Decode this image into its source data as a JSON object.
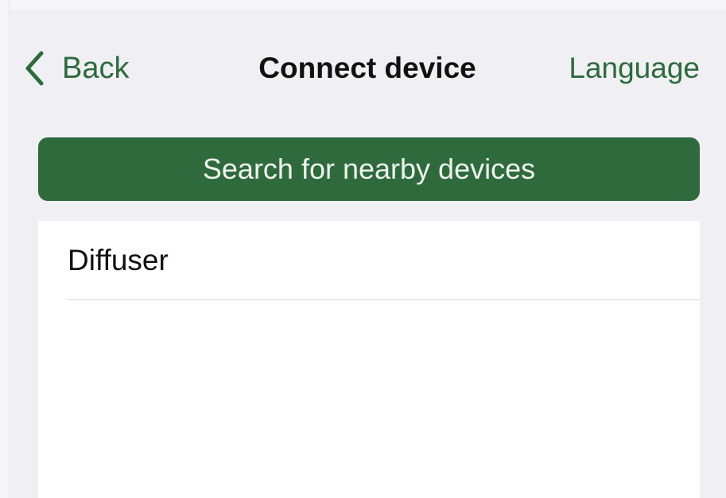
{
  "nav": {
    "back_label": "Back",
    "title": "Connect device",
    "language_label": "Language"
  },
  "search_button": {
    "label": "Search for nearby devices"
  },
  "device_list": {
    "items": [
      {
        "label": "Diffuser"
      }
    ]
  },
  "colors": {
    "accent": "#2d6a3c",
    "button_background": "#2f6a3d",
    "background": "#f0f0f4",
    "list_background": "#ffffff"
  },
  "icons": {
    "back": "chevron-left-icon"
  }
}
